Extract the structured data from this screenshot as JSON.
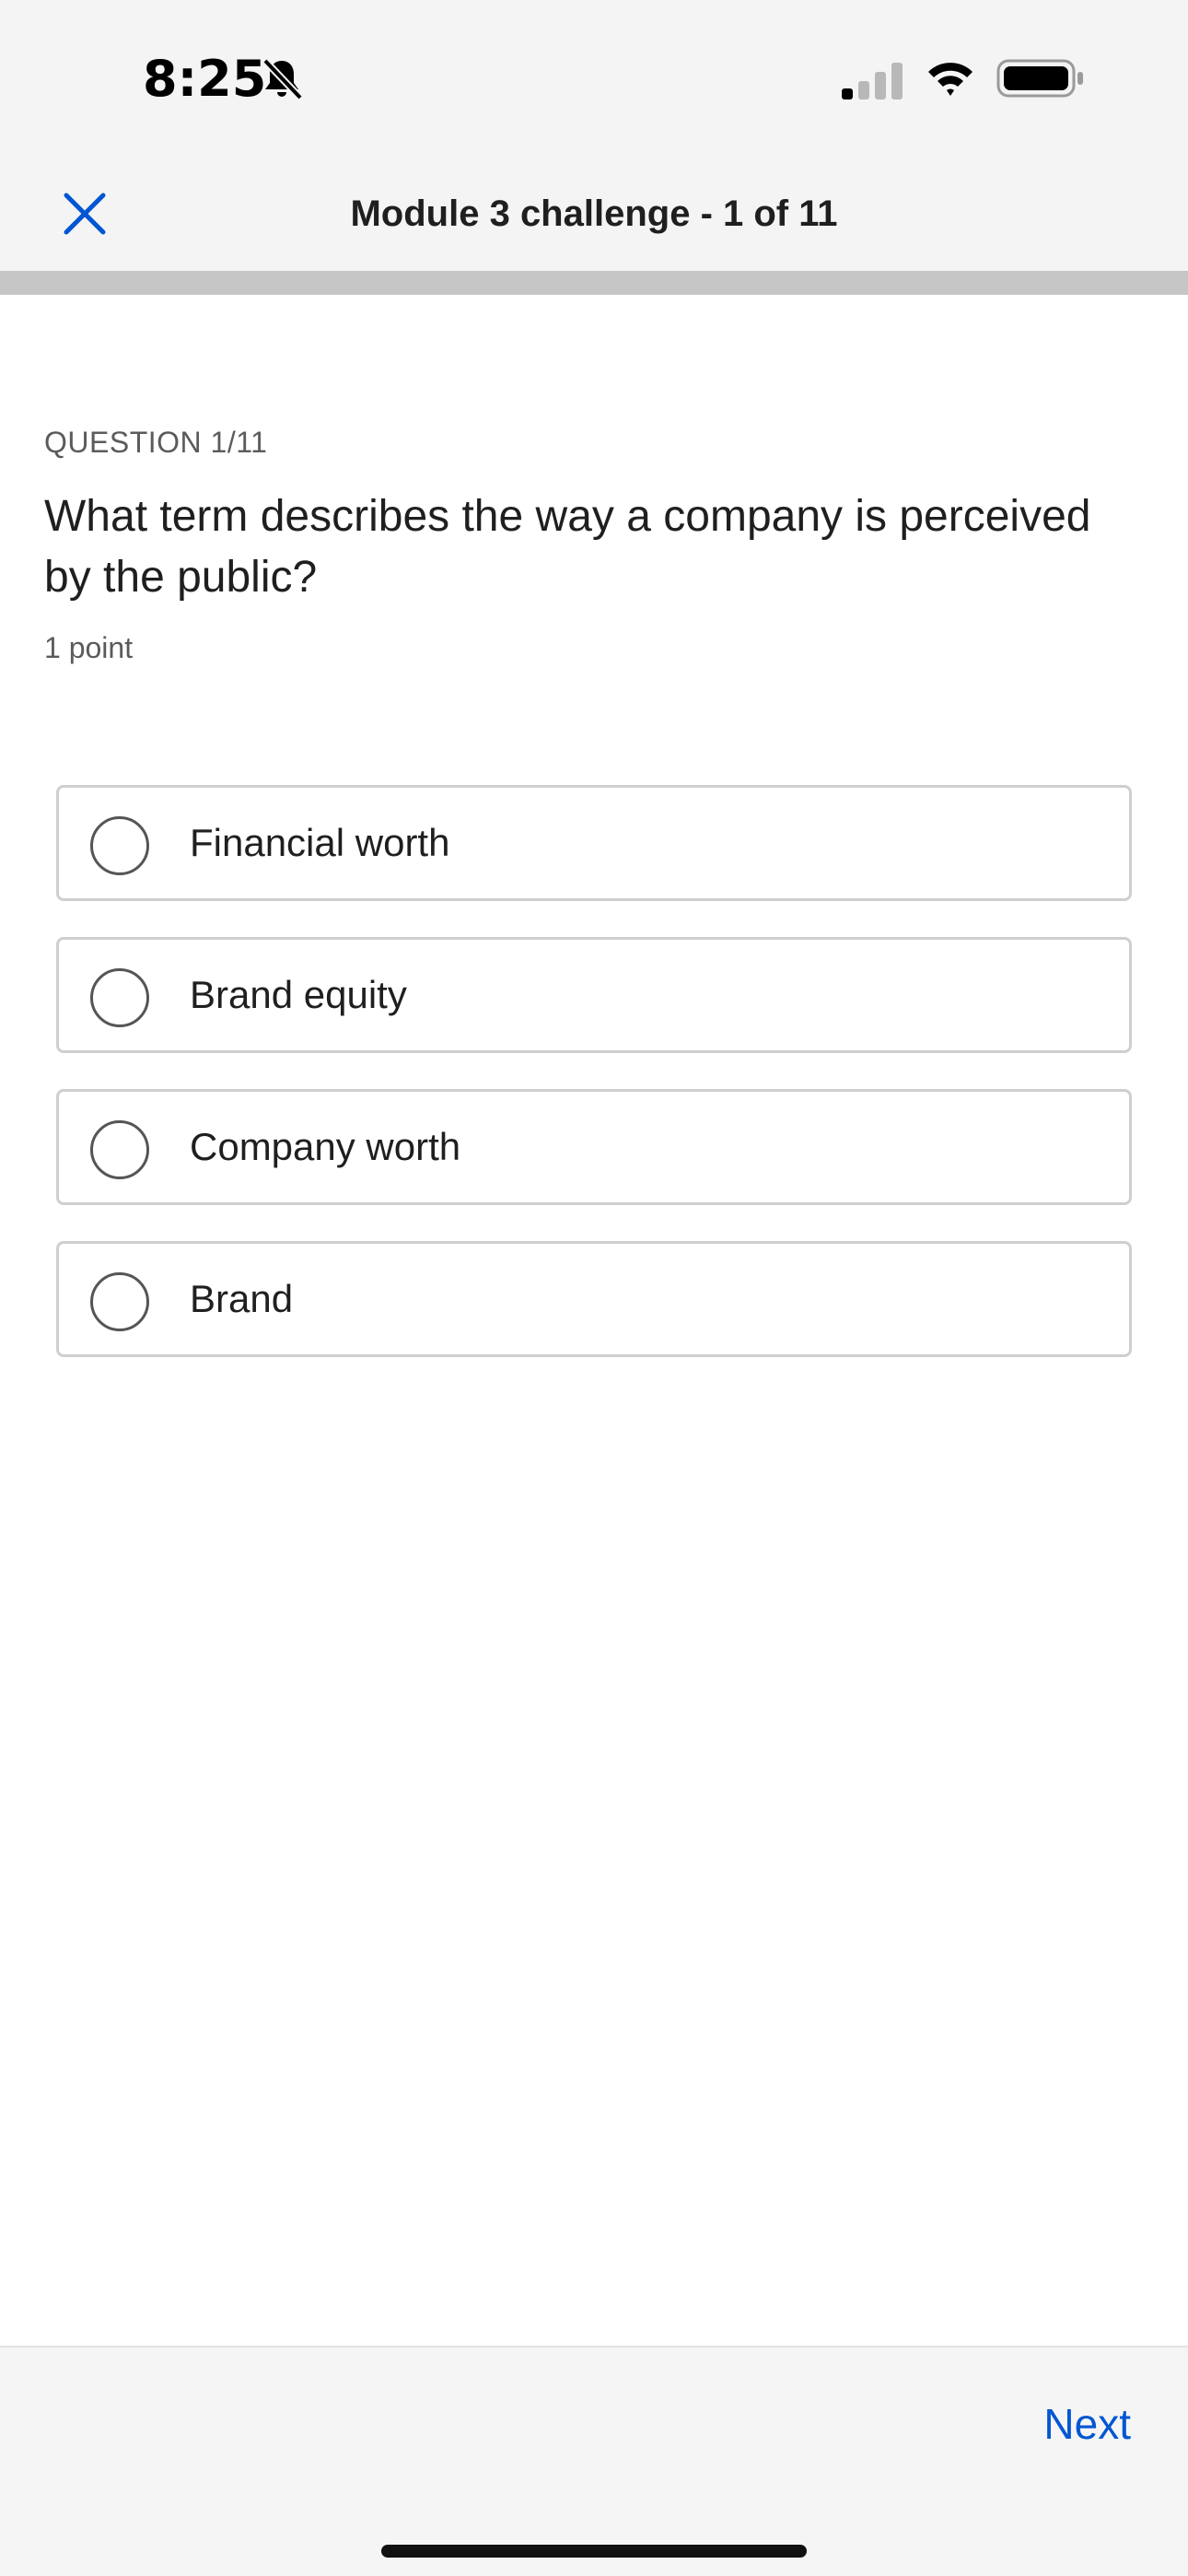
{
  "status_bar": {
    "time": "8:25"
  },
  "header": {
    "title": "Module 3 challenge - 1 of 11"
  },
  "progress": {
    "fraction": 0
  },
  "question": {
    "label": "QUESTION 1/11",
    "text": "What term describes the way a company is perceived by the public?",
    "points": "1 point"
  },
  "options": [
    {
      "label": "Financial worth",
      "selected": false
    },
    {
      "label": "Brand equity",
      "selected": false
    },
    {
      "label": "Company worth",
      "selected": false
    },
    {
      "label": "Brand",
      "selected": false
    }
  ],
  "footer": {
    "next_label": "Next"
  },
  "colors": {
    "accent": "#0056d2",
    "header_bg": "#f4f4f5",
    "progress_track": "#c6c6c6",
    "border": "#cfcfcf",
    "text": "#1f1f1f",
    "muted": "#5b5b5b"
  },
  "icons": {
    "close": "close-icon",
    "bell_off": "bell-slash-icon",
    "signal": "cellular-signal-icon",
    "wifi": "wifi-icon",
    "battery": "battery-icon"
  }
}
